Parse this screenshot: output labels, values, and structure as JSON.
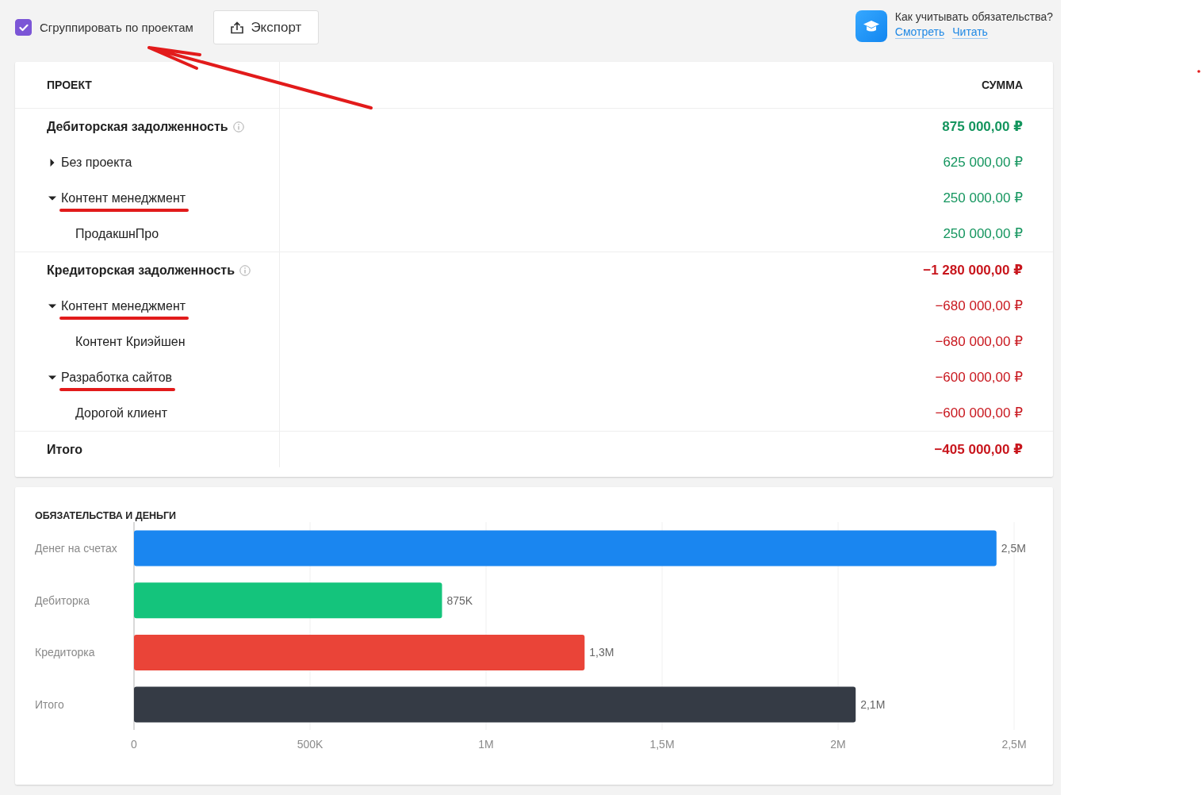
{
  "toolbar": {
    "group_checkbox": {
      "label": "Сгруппировать по проектам",
      "checked": true
    },
    "export_button": "Экспорт"
  },
  "help": {
    "question": "Как учитывать обязательства?",
    "links": [
      "Смотреть",
      "Читать"
    ]
  },
  "table": {
    "columns": [
      "ПРОЕКТ",
      "СУММА"
    ],
    "sections": [
      {
        "label": "Дебиторская задолженность",
        "amount": "875 000,00 ₽",
        "color": "#14955e",
        "rows": [
          {
            "label": "Без проекта",
            "amount": "625 000,00 ₽",
            "expanded": false,
            "underlined": false,
            "children": []
          },
          {
            "label": "Контент менеджмент",
            "amount": "250 000,00 ₽",
            "expanded": true,
            "underlined": true,
            "children": [
              {
                "label": "ПродакшнПро",
                "amount": "250 000,00 ₽"
              }
            ]
          }
        ]
      },
      {
        "label": "Кредиторская задолженность",
        "amount": "−1 280 000,00 ₽",
        "color": "#c8161d",
        "rows": [
          {
            "label": "Контент менеджмент",
            "amount": "−680 000,00 ₽",
            "expanded": true,
            "underlined": true,
            "children": [
              {
                "label": "Контент Криэйшен",
                "amount": "−680 000,00 ₽"
              }
            ]
          },
          {
            "label": "Разработка сайтов",
            "amount": "−600 000,00 ₽",
            "expanded": true,
            "underlined": true,
            "children": [
              {
                "label": "Дорогой клиент",
                "amount": "−600 000,00 ₽"
              }
            ]
          }
        ]
      }
    ],
    "total": {
      "label": "Итого",
      "amount": "−405 000,00 ₽",
      "color": "#c8161d"
    }
  },
  "chart": {
    "title": "ОБЯЗАТЕЛЬСТВА И ДЕНЬГИ",
    "chart_data": {
      "type": "bar",
      "orientation": "horizontal",
      "grid": true,
      "categories": [
        "Денег на счетах",
        "Дебиторка",
        "Кредиторка",
        "Итого"
      ],
      "values": [
        2450000,
        875000,
        1280000,
        2050000
      ],
      "colors": [
        "#1a86f0",
        "#14c47c",
        "#ea4438",
        "#353b45"
      ],
      "value_labels": [
        "2,5M",
        "875K",
        "1,3M",
        "2,1M"
      ],
      "xlim": [
        0,
        2500000
      ],
      "xticks": [
        {
          "value": 0,
          "label": "0"
        },
        {
          "value": 500000,
          "label": "500K"
        },
        {
          "value": 1000000,
          "label": "1M"
        },
        {
          "value": 1500000,
          "label": "1,5M"
        },
        {
          "value": 2000000,
          "label": "2M"
        },
        {
          "value": 2500000,
          "label": "2,5M"
        }
      ]
    }
  }
}
